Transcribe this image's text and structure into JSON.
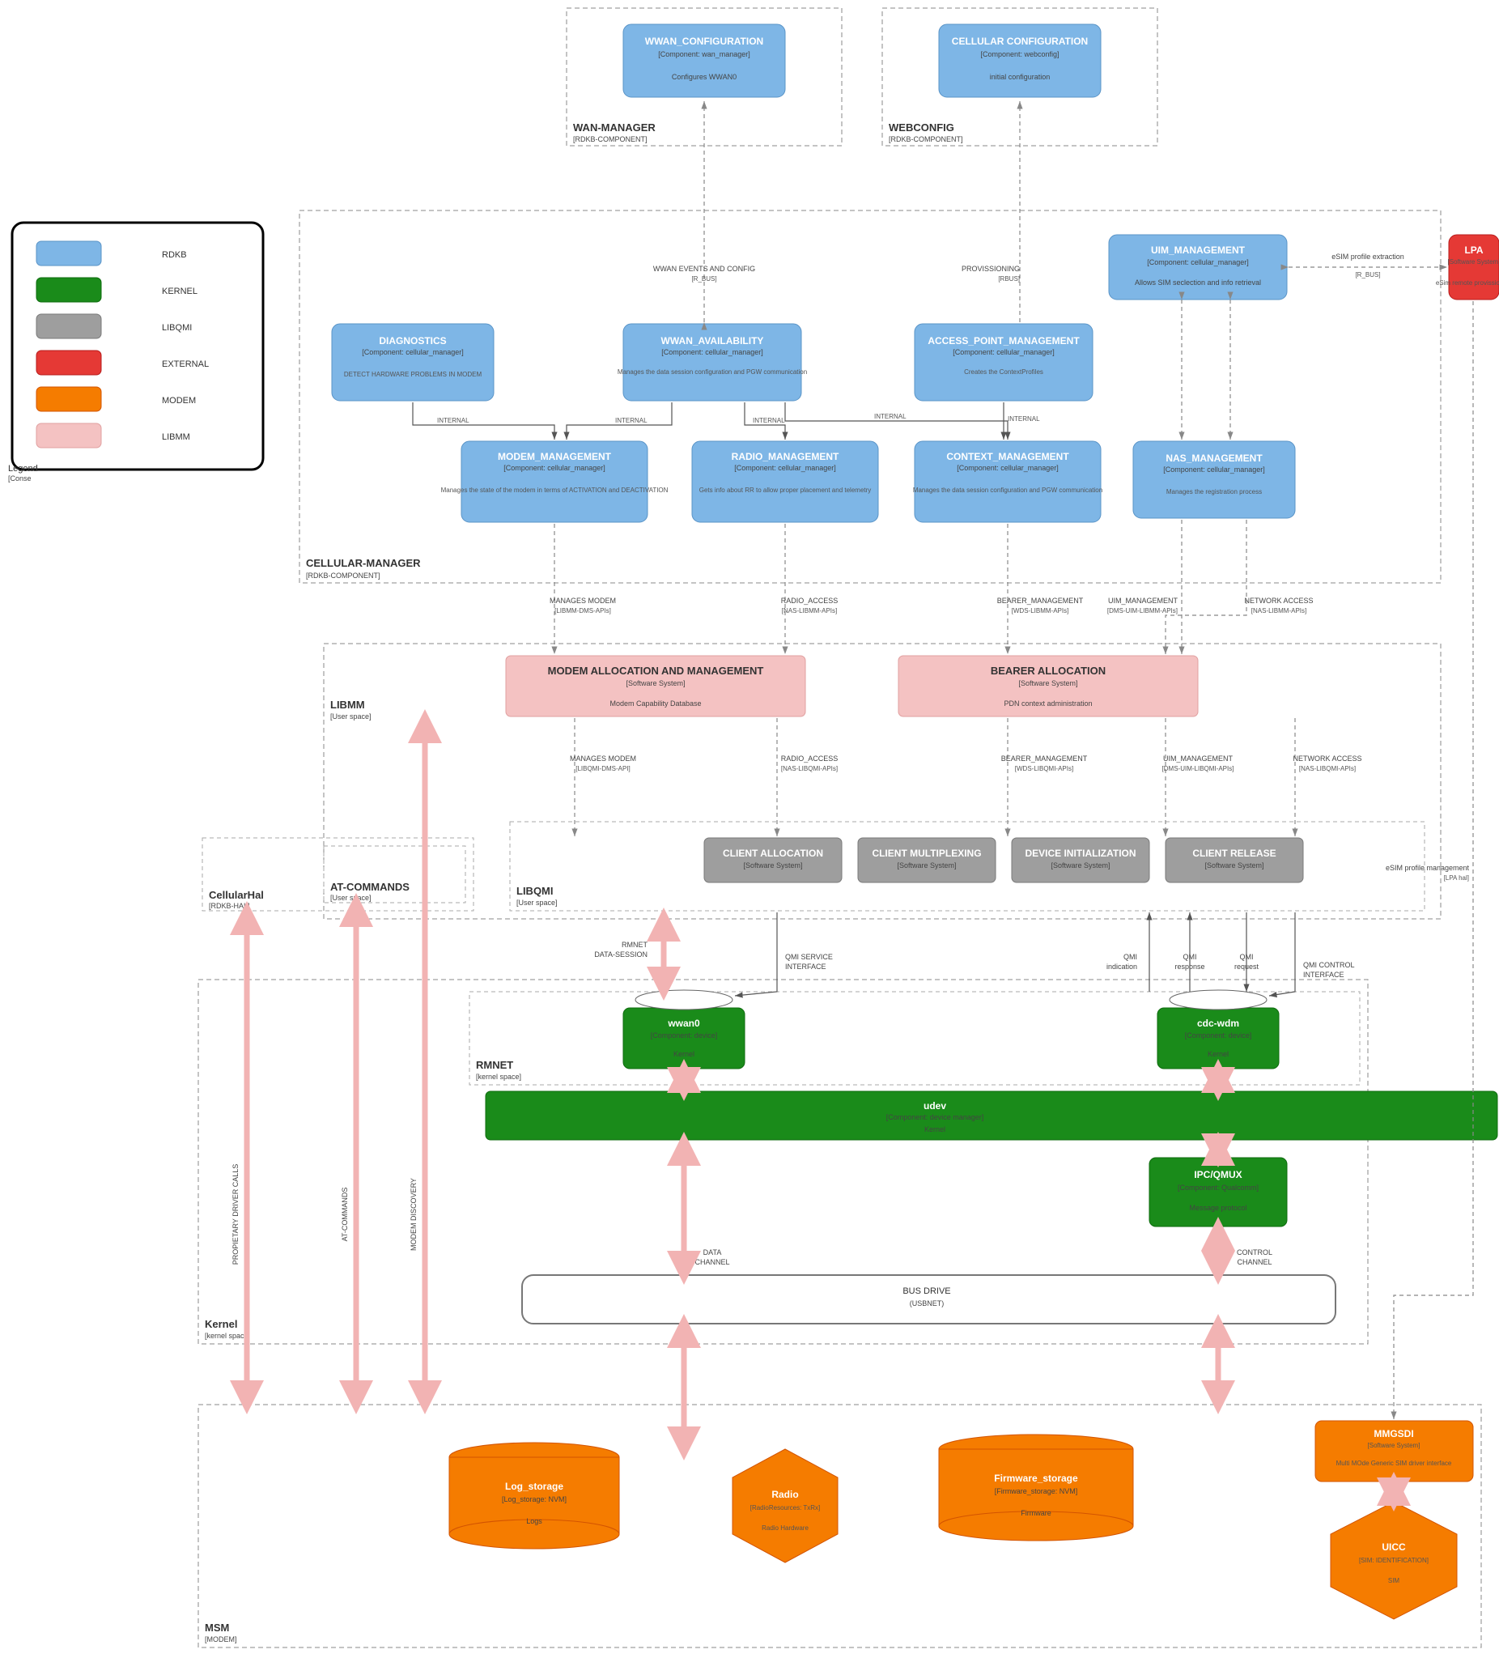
{
  "legend": {
    "title": "Legend",
    "sub": "[Conse",
    "items": [
      {
        "label": "RDKB",
        "cls": "box-rdkb"
      },
      {
        "label": "KERNEL",
        "cls": "box-kernel"
      },
      {
        "label": "LIBQMI",
        "cls": "box-libqmi"
      },
      {
        "label": "EXTERNAL",
        "cls": "box-external"
      },
      {
        "label": "MODEM",
        "cls": "box-modem"
      },
      {
        "label": "LIBMM",
        "cls": "box-libmm"
      }
    ]
  },
  "groups": {
    "wanmgr": {
      "title": "WAN-MANAGER",
      "sub": "[RDKB-COMPONENT]"
    },
    "webcfg": {
      "title": "WEBCONFIG",
      "sub": "[RDKB-COMPONENT]"
    },
    "cellmgr": {
      "title": "CELLULAR-MANAGER",
      "sub": "[RDKB-COMPONENT]"
    },
    "libmm": {
      "title": "LIBMM",
      "sub": "[User space]"
    },
    "libqmi": {
      "title": "LIBQMI",
      "sub": "[User space]"
    },
    "atcmd": {
      "title": "AT-COMMANDS",
      "sub": "[User space]"
    },
    "cellhal": {
      "title": "CellularHal",
      "sub": "[RDKB-HAL]"
    },
    "rmnet": {
      "title": "RMNET",
      "sub": "[kernel space]"
    },
    "kernel": {
      "title": "Kernel",
      "sub": "[kernel space]"
    },
    "msm": {
      "title": "MSM",
      "sub": "[MODEM]"
    }
  },
  "nodes": {
    "wwan_cfg": {
      "t": "WWAN_CONFIGURATION",
      "c": "[Component: wan_manager]",
      "d": "Configures WWAN0"
    },
    "cell_cfg": {
      "t": "CELLULAR CONFIGURATION",
      "c": "[Component: webconfig]",
      "d": "initial configuration"
    },
    "uim_mgmt": {
      "t": "UIM_MANAGEMENT",
      "c": "[Component: cellular_manager]",
      "d": "Allows SIM seclection and info retrieval"
    },
    "lpa": {
      "t": "LPA",
      "c": "[Software System]",
      "d": "eSim remote provissioning"
    },
    "diag": {
      "t": "DIAGNOSTICS",
      "c": "[Component: cellular_manager]",
      "d": "DETECT HARDWARE PROBLEMS IN MODEM"
    },
    "wwan_avail": {
      "t": "WWAN_AVAILABILITY",
      "c": "[Component: cellular_manager]",
      "d": "Manages the data session configuration and PGW communication"
    },
    "ap_mgmt": {
      "t": "ACCESS_POINT_MANAGEMENT",
      "c": "[Component: cellular_manager]",
      "d": "Creates the ContextProfiles"
    },
    "modem_mgmt": {
      "t": "MODEM_MANAGEMENT",
      "c": "[Component: cellular_manager]",
      "d": "Manages the state of the modem in terms of ACTIVATION and DEACTIVATION"
    },
    "radio_mgmt": {
      "t": "RADIO_MANAGEMENT",
      "c": "[Component: cellular_manager]",
      "d": "Gets info about RR to allow proper placement and telemetry"
    },
    "ctx_mgmt": {
      "t": "CONTEXT_MANAGEMENT",
      "c": "[Component: cellular_manager]",
      "d": "Manages the data session configuration and PGW communication"
    },
    "nas_mgmt": {
      "t": "NAS_MANAGEMENT",
      "c": "[Component: cellular_manager]",
      "d": "Manages the registration process"
    },
    "modem_alloc": {
      "t": "MODEM ALLOCATION AND MANAGEMENT",
      "c": "[Software System]",
      "d": "Modem Capability Database"
    },
    "bearer_alloc": {
      "t": "BEARER ALLOCATION",
      "c": "[Software System]",
      "d": "PDN context administration"
    },
    "client_alloc": {
      "t": "CLIENT ALLOCATION",
      "c": "[Software System]",
      "d": ""
    },
    "client_mux": {
      "t": "CLIENT MULTIPLEXING",
      "c": "[Software System]",
      "d": ""
    },
    "dev_init": {
      "t": "DEVICE INITIALIZATION",
      "c": "[Software System]",
      "d": ""
    },
    "client_rel": {
      "t": "CLIENT RELEASE",
      "c": "[Software System]",
      "d": ""
    },
    "wwan0": {
      "t": "wwan0",
      "c": "[Component: device]",
      "d": "Kernel"
    },
    "cdcwdm": {
      "t": "cdc-wdm",
      "c": "[Component: device]",
      "d": "Kernel"
    },
    "udev": {
      "t": "udev",
      "c": "[Component: device manager]",
      "d": "Kernel"
    },
    "ipcqmux": {
      "t": "IPC/QMUX",
      "c": "[Component: Qualcomm]",
      "d": "Message protocol"
    },
    "busdrive": {
      "t": "BUS DRIVE",
      "d": "(USBNET)"
    },
    "logstore": {
      "t": "Log_storage",
      "c": "[Log_storage: NVM]",
      "d": "Logs"
    },
    "radio": {
      "t": "Radio",
      "c": "[RadioResources: TxRx]",
      "d": "Radio Hardware"
    },
    "fwstore": {
      "t": "Firmware_storage",
      "c": "[Firmware_storage: NVM]",
      "d": "Firmware"
    },
    "mmgsdi": {
      "t": "MMGSDI",
      "c": "[Software System]",
      "d": "Multi MOde Generic SIM driver interface"
    },
    "uicc": {
      "t": "UICC",
      "c": "[SIM: IDENTIFICATION]",
      "d": "SIM"
    }
  },
  "labels": {
    "wwan_events": "WWAN EVENTS AND CONFIG",
    "wwan_events_sub": "[R_BUS]",
    "provisioning": "PROVISSIONING",
    "provisioning_sub": "[RBUS]",
    "esim_ext": "eSIM profile extraction",
    "esim_ext_sub": "[R_BUS]",
    "internal": "INTERNAL",
    "manages_modem": "MANAGES MODEM",
    "libmm_dms": "[LIBMM-DMS-APIs]",
    "radio_access": "RADIO_ACCESS",
    "nas_libmm": "[NAS-LIBMM-APIs]",
    "bearer_mgmt": "BEARER_MANAGEMENT",
    "wds_libmm": "[WDS-LIBMM-APIs]",
    "uim_mgmt_l": "UIM_MANAGEMENT",
    "dms_uim_libmm": "[DMS-UIM-LIBMM-APIs]",
    "net_access": "NETWORK ACCESS",
    "libqmi_dms": "[LIBQMI-DMS-API]",
    "nas_libqmi": "[NAS-LIBQMI-APIs]",
    "wds_libqmi": "[WDS-LIBQMI-APIs]",
    "dms_uim_libqmi": "[DMS-UIM-LIBQMI-APIs]",
    "esim_prof_mgmt": "eSIM profile management",
    "lpa_hal": "[LPA hal]",
    "rmnet_ds": "RMNET",
    "rmnet_ds2": "DATA-SESSION",
    "qmi_svc": "QMI SERVICE",
    "interface": "INTERFACE",
    "qmi_ind": "QMI",
    "qmi_ind2": "indication",
    "qmi_resp": "QMI",
    "qmi_resp2": "response",
    "qmi_req": "QMI",
    "qmi_req2": "request",
    "qmi_ctrl": "QMI CONTROL",
    "data_ch": "DATA",
    "channel": "CHANNEL",
    "ctrl_ch": "CONTROL",
    "prop_calls": "PROPIETARY DRIVER CALLS",
    "at_cmds": "AT-COMMANDS",
    "modem_disc": "MODEM DISCOVERY"
  }
}
